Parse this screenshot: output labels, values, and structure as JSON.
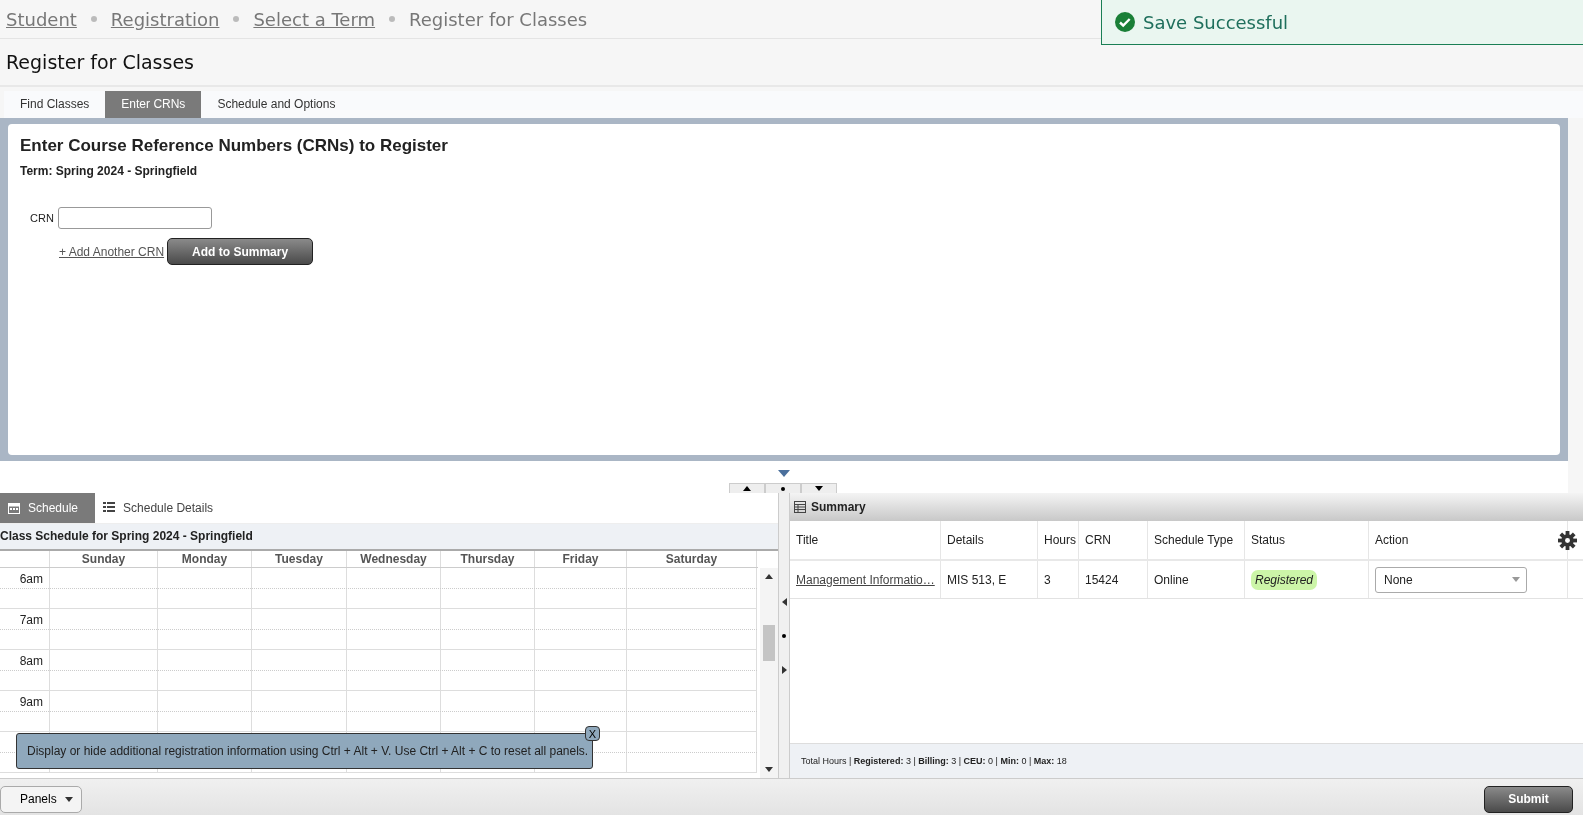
{
  "breadcrumb": [
    {
      "label": "Student",
      "link": true
    },
    {
      "label": "Registration",
      "link": true
    },
    {
      "label": "Select a Term",
      "link": true
    },
    {
      "label": "Register for Classes",
      "link": false
    }
  ],
  "toast": {
    "message": "Save Successful"
  },
  "page_title": "Register for Classes",
  "tabs": [
    {
      "label": "Find Classes",
      "selected": false
    },
    {
      "label": "Enter CRNs",
      "selected": true
    },
    {
      "label": "Schedule and Options",
      "selected": false
    }
  ],
  "crn_panel": {
    "heading": "Enter Course Reference Numbers (CRNs) to Register",
    "term": "Term: Spring 2024 - Springfield",
    "crn_label": "CRN",
    "add_link": "+ Add Another CRN",
    "add_button": "Add to Summary"
  },
  "schedule_pane": {
    "tabs": [
      {
        "label": "Schedule",
        "selected": true
      },
      {
        "label": "Schedule Details",
        "selected": false
      }
    ],
    "title": "Class Schedule for Spring 2024 - Springfield",
    "days": [
      "Sunday",
      "Monday",
      "Tuesday",
      "Wednesday",
      "Thursday",
      "Friday",
      "Saturday"
    ],
    "times": [
      "6am",
      "7am",
      "8am",
      "9am"
    ],
    "tip": {
      "text": "Display or hide additional registration information using Ctrl + Alt + V. Use Ctrl + Alt + C to reset all panels.",
      "close_label": "X"
    }
  },
  "summary": {
    "title": "Summary",
    "columns": [
      "Title",
      "Details",
      "Hours",
      "CRN",
      "Schedule Type",
      "Status",
      "Action"
    ],
    "rows": [
      {
        "title": "Management Informatio…",
        "details": "MIS 513, E",
        "hours": "3",
        "crn": "15424",
        "schedule_type": "Online",
        "status": "Registered",
        "action": "None"
      }
    ],
    "totals": "Total Hours | **Registered:** 3 | **Billing:** 3 | **CEU:** 0 | **Min:** 0 | **Max:** 18"
  },
  "footer": {
    "panels_button": "Panels",
    "submit_button": "Submit"
  }
}
